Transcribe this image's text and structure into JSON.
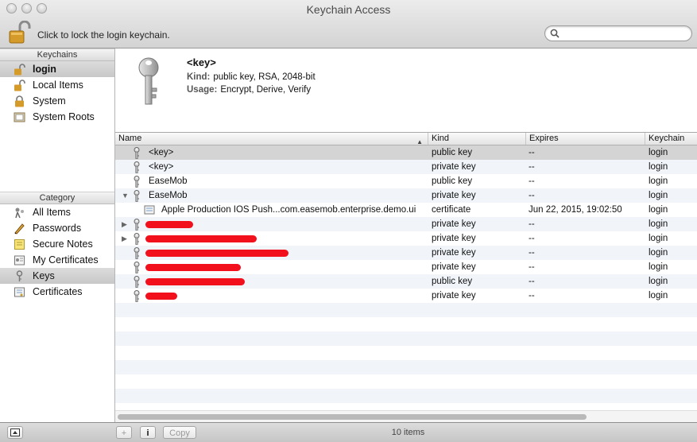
{
  "window": {
    "title": "Keychain Access"
  },
  "toolbar": {
    "lock_label": "Click to lock the login keychain.",
    "search_placeholder": ""
  },
  "sidebar": {
    "keychains_header": "Keychains",
    "keychains": [
      {
        "label": "login",
        "icon": "lock-open-icon",
        "selected": true
      },
      {
        "label": "Local Items",
        "icon": "lock-open-icon",
        "selected": false
      },
      {
        "label": "System",
        "icon": "lock-icon",
        "selected": false
      },
      {
        "label": "System Roots",
        "icon": "folder-icon",
        "selected": false
      }
    ],
    "category_header": "Category",
    "categories": [
      {
        "label": "All Items",
        "icon": "all-items-icon",
        "selected": false
      },
      {
        "label": "Passwords",
        "icon": "pencil-icon",
        "selected": false
      },
      {
        "label": "Secure Notes",
        "icon": "note-icon",
        "selected": false
      },
      {
        "label": "My Certificates",
        "icon": "my-certificate-icon",
        "selected": false
      },
      {
        "label": "Keys",
        "icon": "key-icon",
        "selected": true
      },
      {
        "label": "Certificates",
        "icon": "certificate-icon",
        "selected": false
      }
    ]
  },
  "info": {
    "title": "<key>",
    "kind_label": "Kind:",
    "kind_value": "public key, RSA, 2048-bit",
    "usage_label": "Usage:",
    "usage_value": "Encrypt, Derive, Verify"
  },
  "table": {
    "columns": [
      "Name",
      "Kind",
      "Expires",
      "Keychain"
    ],
    "rows": [
      {
        "name": "<key>",
        "kind": "public key",
        "expires": "--",
        "keychain": "login",
        "selected": true
      },
      {
        "name": "<key>",
        "kind": "private key",
        "expires": "--",
        "keychain": "login"
      },
      {
        "name": "EaseMob",
        "kind": "public key",
        "expires": "--",
        "keychain": "login"
      },
      {
        "name": "EaseMob",
        "kind": "private key",
        "expires": "--",
        "keychain": "login",
        "disclosure": "open"
      },
      {
        "name": "Apple Production IOS Push...com.easemob.enterprise.demo.ui",
        "kind": "certificate",
        "expires": "Jun 22, 2015, 19:02:50",
        "keychain": "login",
        "child": true
      },
      {
        "name": "",
        "kind": "private key",
        "expires": "--",
        "keychain": "login",
        "disclosure": "closed",
        "redacted": true
      },
      {
        "name": "",
        "kind": "private key",
        "expires": "--",
        "keychain": "login",
        "disclosure": "closed",
        "redacted": true
      },
      {
        "name": "",
        "kind": "private key",
        "expires": "--",
        "keychain": "login",
        "redacted": true
      },
      {
        "name": "",
        "kind": "private key",
        "expires": "--",
        "keychain": "login",
        "redacted": true
      },
      {
        "name": "",
        "kind": "public key",
        "expires": "--",
        "keychain": "login",
        "redacted": true
      },
      {
        "name": "",
        "kind": "private key",
        "expires": "--",
        "keychain": "login",
        "redacted": true
      }
    ]
  },
  "bottom": {
    "add_label": "+",
    "info_label": "i",
    "copy_label": "Copy",
    "count": "10 items"
  },
  "colors": {
    "selected_row": "#d4d4d4",
    "stripe": "#f1f5fa",
    "redaction": "#f2101d"
  }
}
